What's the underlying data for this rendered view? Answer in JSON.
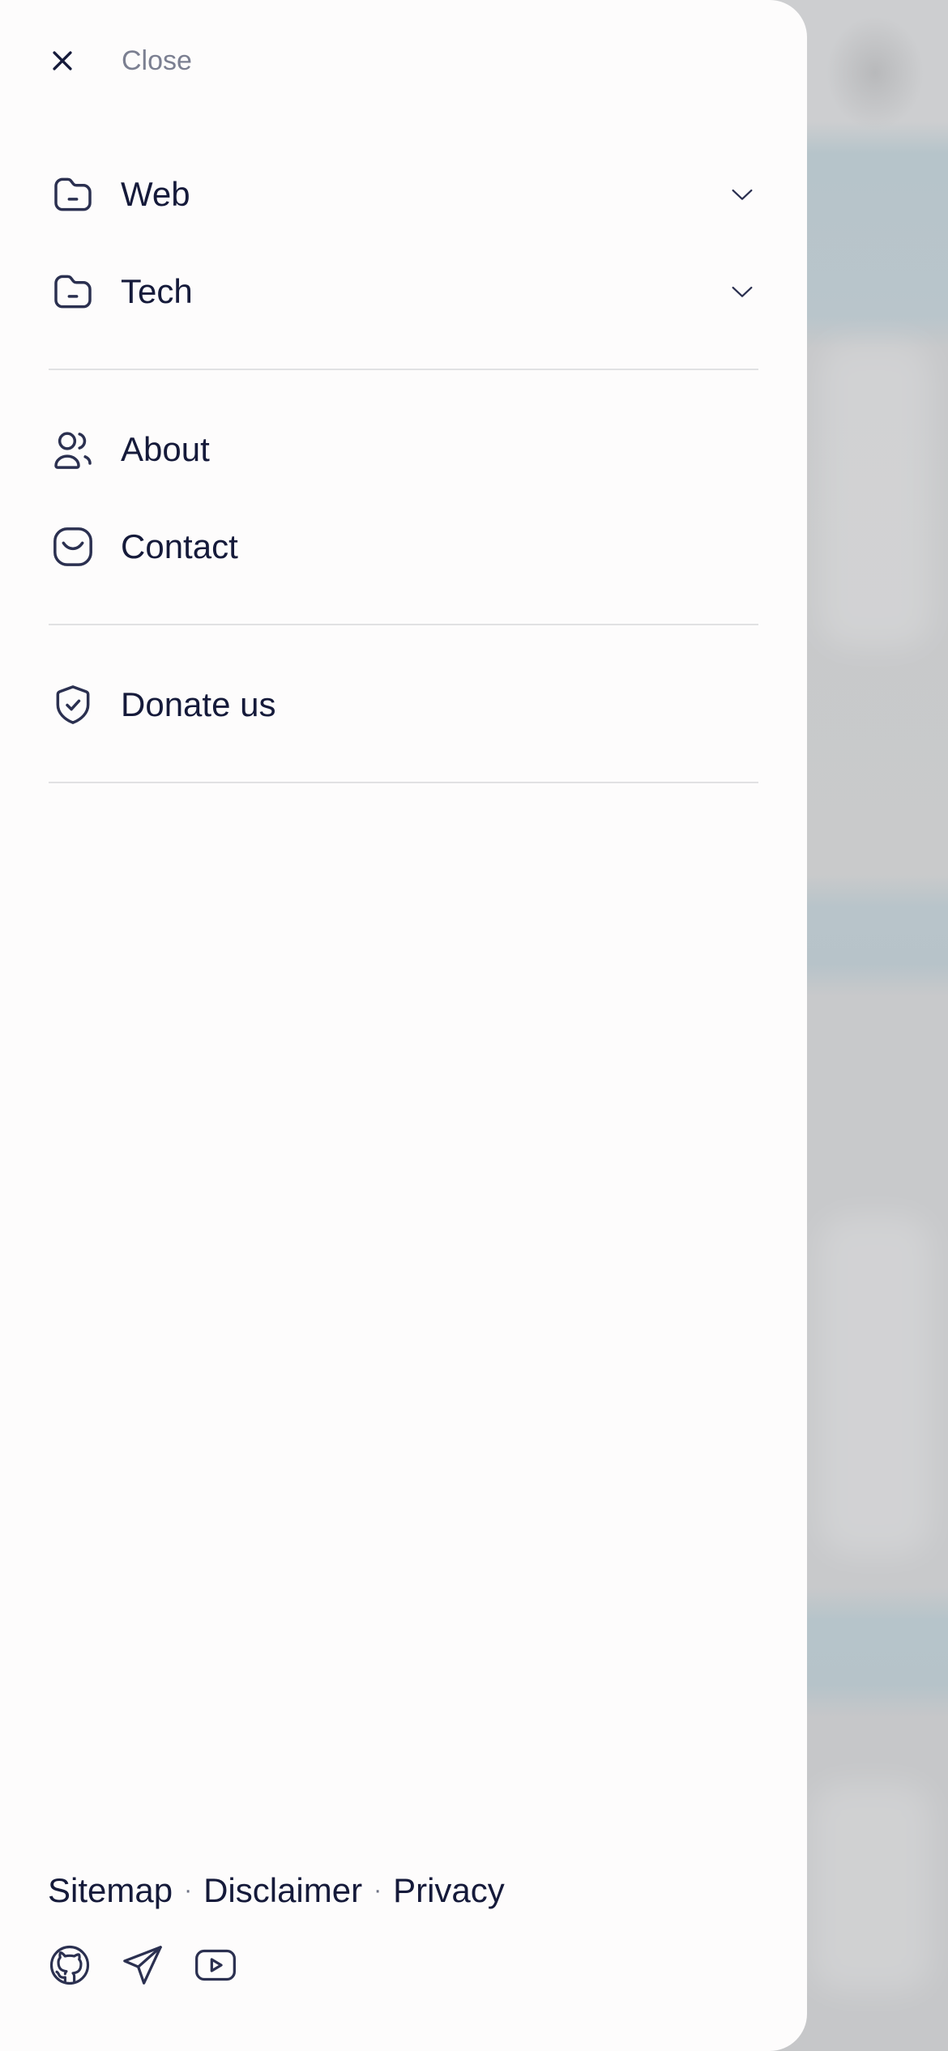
{
  "close": {
    "label": "Close",
    "icon": "close-icon"
  },
  "menu": {
    "categories": [
      {
        "label": "Web",
        "icon": "folder-icon",
        "expand_icon": "chevron-down-icon"
      },
      {
        "label": "Tech",
        "icon": "folder-icon",
        "expand_icon": "chevron-down-icon"
      }
    ],
    "pages": [
      {
        "label": "About",
        "icon": "users-icon"
      },
      {
        "label": "Contact",
        "icon": "mail-icon"
      }
    ],
    "support": [
      {
        "label": "Donate us",
        "icon": "shield-check-icon"
      }
    ]
  },
  "footer": {
    "links": [
      "Sitemap",
      "Disclaimer",
      "Privacy"
    ],
    "separator": "·",
    "social": [
      {
        "icon": "github-icon"
      },
      {
        "icon": "telegram-icon"
      },
      {
        "icon": "youtube-icon"
      }
    ]
  },
  "colors": {
    "drawer_bg": "#fdfcfc",
    "text_primary": "#151a3a",
    "text_muted": "#7b7f91",
    "divider": "#e1e1e3",
    "backdrop": "#c6c8ca"
  }
}
